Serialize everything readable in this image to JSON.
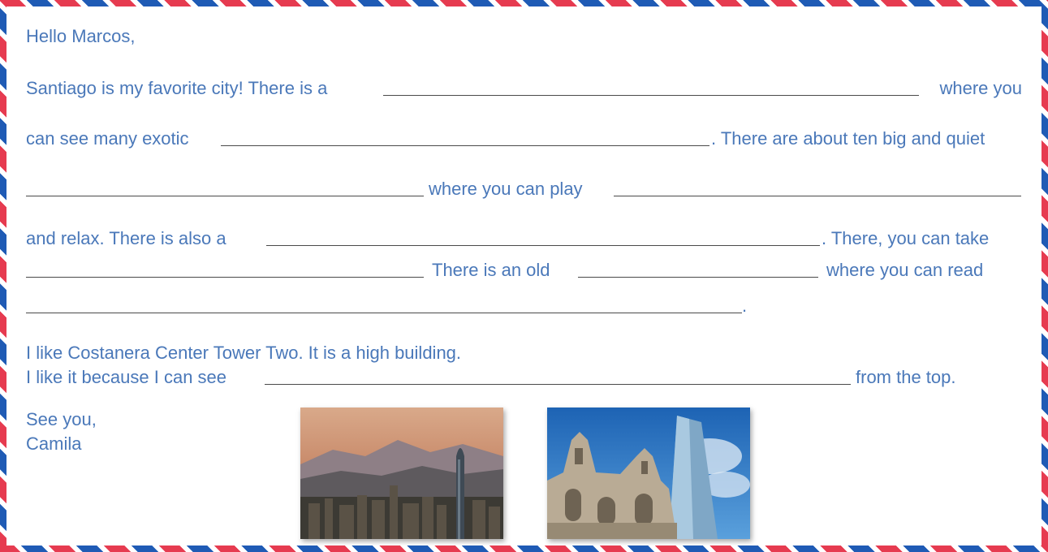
{
  "greeting": "Hello Marcos,",
  "line1": {
    "a": "Santiago is my favorite city! There is a",
    "b": "where you"
  },
  "line2": {
    "a": "can see many exotic",
    "b": ". There are about ten big and quiet"
  },
  "line3": {
    "a": "where you can play"
  },
  "line4": {
    "a": "and relax. There is  also a",
    "b": ". There, you can take"
  },
  "line5": {
    "a": "There is an old",
    "b": "where you can read"
  },
  "line6": {
    "a": "."
  },
  "line7": "I like Costanera Center Tower Two. It is a high building.",
  "line8": {
    "a": "I like it because I can see",
    "b": "from the top."
  },
  "closing": "See you,",
  "signature": "Camila",
  "colors": {
    "text": "#4a78b9",
    "stripe_red": "#e63b50",
    "stripe_blue": "#1f5bb5"
  },
  "icons": [
    "santiago-skyline-photo",
    "cathedral-photo"
  ]
}
